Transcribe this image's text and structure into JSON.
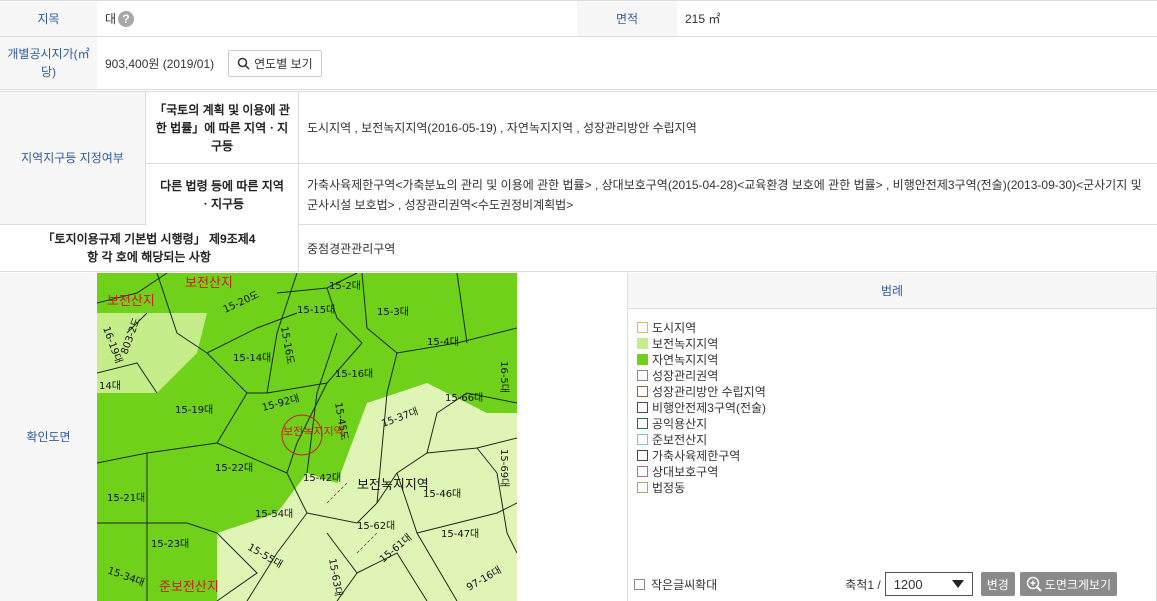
{
  "rows": {
    "jimok": {
      "label": "지목",
      "value": "대",
      "help": "?"
    },
    "area": {
      "label": "면적",
      "value": "215 ㎡"
    },
    "price": {
      "label": "개별공시지가(㎡당)",
      "value": "903,400원 (2019/01)",
      "button": "연도별 보기"
    },
    "zone": {
      "label": "지역지구등 지정여부",
      "law1_label": "「국토의 계획 및 이용에 관한 법률」에 따른 지역ㆍ지구등",
      "law1_value": "도시지역 , 보전녹지지역(2016-05-19) , 자연녹지지역 , 성장관리방안 수립지역",
      "law2_label": "다른 법령 등에 따른 지역ㆍ지구등",
      "law2_value": "가축사육제한구역<가축분뇨의 관리 및 이용에 관한 법률> , 상대보호구역(2015-04-28)<교육환경 보호에 관한 법률> , 비행안전제3구역(전술)(2013-09-30)<군사기지 및 군사시설 보호법> , 성장관리권역<수도권정비계획법>"
    },
    "enforce": {
      "label": "「토지이용규제 기본법 시행령」 제9조제4항 각 호에 해당되는 사항",
      "value": "중점경관관리구역"
    },
    "map": {
      "label": "확인도면"
    }
  },
  "map_labels": {
    "l1": "보전산지",
    "l2": "보전산지",
    "l3": "15-20도",
    "l4": "15-2대",
    "l5": "15-15대",
    "l6": "15-3대",
    "l7": "15-14대",
    "l8": "15-4대",
    "l9": "16-19대",
    "l10": "15-16대",
    "l11": "14대",
    "l12": "15-19대",
    "l13": "15-92대",
    "l14": "15-66대",
    "l15": "15-37대",
    "l16": "15-45도",
    "l17": "15-22대",
    "l18": "15-42대",
    "l19": "15-46대",
    "l20": "보전녹지지역",
    "l21": "15-21대",
    "l22": "15-54대",
    "l23": "15-23대",
    "l24": "15-62대",
    "l25": "15-47대",
    "l26": "15-55대",
    "l27": "15-61대",
    "l28": "15-63대",
    "l29": "준보전산지",
    "l30": "보전녹지지역",
    "l31": "15-69대",
    "l32": "16-5대",
    "l33": "803-2도",
    "l34": "15-16도",
    "l35": "15-34대",
    "l36": "97-16대"
  },
  "legend": {
    "title": "범례",
    "items": [
      {
        "label": "도시지역",
        "color": "#ffffff",
        "border": "#d4c04a"
      },
      {
        "label": "보전녹지지역",
        "color": "#c5ee8a",
        "border": "#c5ee8a"
      },
      {
        "label": "자연녹지지역",
        "color": "#6fd11a",
        "border": "#6fd11a"
      },
      {
        "label": "성장관리권역",
        "color": "#ffffff",
        "border": "#888888"
      },
      {
        "label": "성장관리방안 수립지역",
        "color": "#ffffff",
        "border": "#8a6a3a"
      },
      {
        "label": "비행안전제3구역(전술)",
        "color": "#ffffff",
        "border": "#3a4a6a"
      },
      {
        "label": "공익용산지",
        "color": "#ffffff",
        "border": "#1f6a5a"
      },
      {
        "label": "준보전산지",
        "color": "#ffffff",
        "border": "#7ac8c0"
      },
      {
        "label": "가축사육제한구역",
        "color": "#ffffff",
        "border": "#444444"
      },
      {
        "label": "상대보호구역",
        "color": "#ffffff",
        "border": "#b06aa0"
      },
      {
        "label": "법정동",
        "color": "#ffffff",
        "border": "#b4a070"
      }
    ],
    "small_text": "작은글씨확대",
    "scale_label": "축척1 /",
    "scale_value": "1200",
    "change_btn": "변경",
    "enlarge_btn": "도면크게보기"
  },
  "colors": {
    "header_blue": "#2f5aa8",
    "natural_green": "#6fd11a",
    "conservation_green": "#c5ee8a",
    "button_gray": "#8a8a8a"
  }
}
